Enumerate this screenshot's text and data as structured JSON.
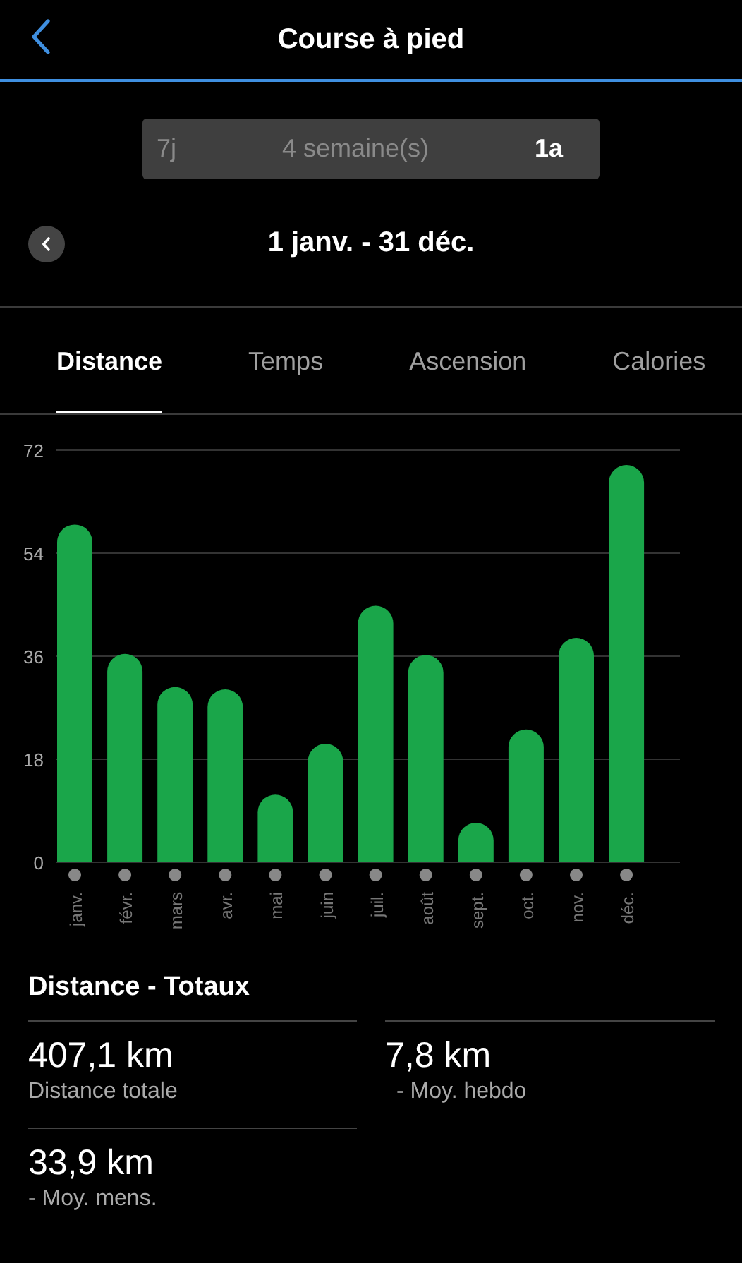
{
  "header": {
    "title": "Course à pied"
  },
  "periods": [
    {
      "label": "7j",
      "selected": false
    },
    {
      "label": "4 semaine(s)",
      "selected": false
    },
    {
      "label": "1a",
      "selected": true
    }
  ],
  "date_range": {
    "label": "1 janv. - 31 déc."
  },
  "tabs": [
    {
      "label": "Distance",
      "selected": true
    },
    {
      "label": "Temps",
      "selected": false
    },
    {
      "label": "Ascension",
      "selected": false
    },
    {
      "label": "Calories",
      "selected": false
    }
  ],
  "chart": {
    "chart_data": {
      "type": "bar",
      "categories": [
        "janv.",
        "févr.",
        "mars",
        "avr.",
        "mai",
        "juin",
        "juil.",
        "août",
        "sept.",
        "oct.",
        "nov.",
        "déc."
      ],
      "series": [
        {
          "color": "#1aa64a",
          "values": [
            59.0,
            36.4,
            30.6,
            30.2,
            11.8,
            20.7,
            44.8,
            36.2,
            6.9,
            23.2,
            39.2,
            69.4
          ]
        }
      ],
      "grid": true,
      "ylim": [
        0,
        72
      ],
      "yticks": [
        0,
        18,
        36,
        54,
        72
      ]
    }
  },
  "totals": {
    "title": "Distance - Totaux",
    "stats": [
      {
        "value": "407,1 km",
        "label": "Distance totale"
      },
      {
        "value": "7,8 km",
        "label": "- Moy. hebdo"
      },
      {
        "value": "33,9 km",
        "label": "- Moy. mens."
      }
    ]
  }
}
